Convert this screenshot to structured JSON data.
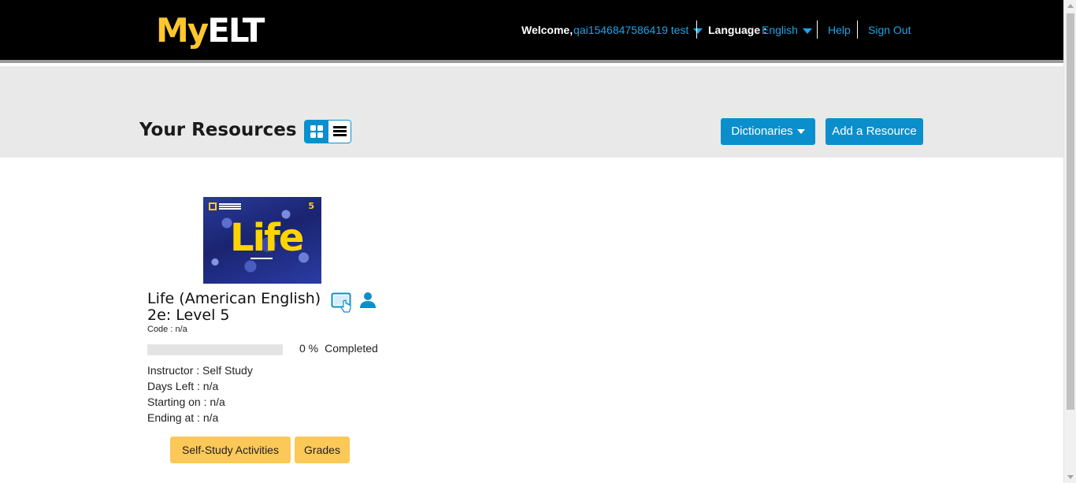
{
  "header": {
    "logo_my": "My",
    "logo_elt": "ELT",
    "welcome_label": "Welcome,",
    "username": "qai1546847586419 test",
    "language_label": "Language :",
    "language_value": "English",
    "help": "Help",
    "sign_out": "Sign Out"
  },
  "resources_bar": {
    "title": "Your Resources",
    "dictionaries_button": "Dictionaries",
    "add_resource_button": "Add a Resource"
  },
  "resource_card": {
    "cover_word": "Life",
    "cover_level": "5",
    "title": "Life (American English) 2e: Level 5",
    "code": "Code : n/a",
    "progress_percent": 0,
    "progress_value": "0 %",
    "progress_label": "Completed",
    "instructor": "Instructor : Self Study",
    "days_left": "Days Left : n/a",
    "starting_on": "Starting on : n/a",
    "ending_at": "Ending at : n/a",
    "self_study_button": "Self-Study Activities",
    "grades_button": "Grades"
  },
  "colors": {
    "header_bg": "#000000",
    "logo_accent": "#ffc72c",
    "link_blue": "#1ea3e3",
    "button_blue": "#0b8fcc",
    "button_yellow": "#fcc858",
    "band_gray": "#e9e9e9"
  },
  "icons": {
    "tablet": "tablet-touch-icon",
    "user": "user-icon",
    "grid_view": "grid-view-icon",
    "list_view": "list-view-icon"
  }
}
